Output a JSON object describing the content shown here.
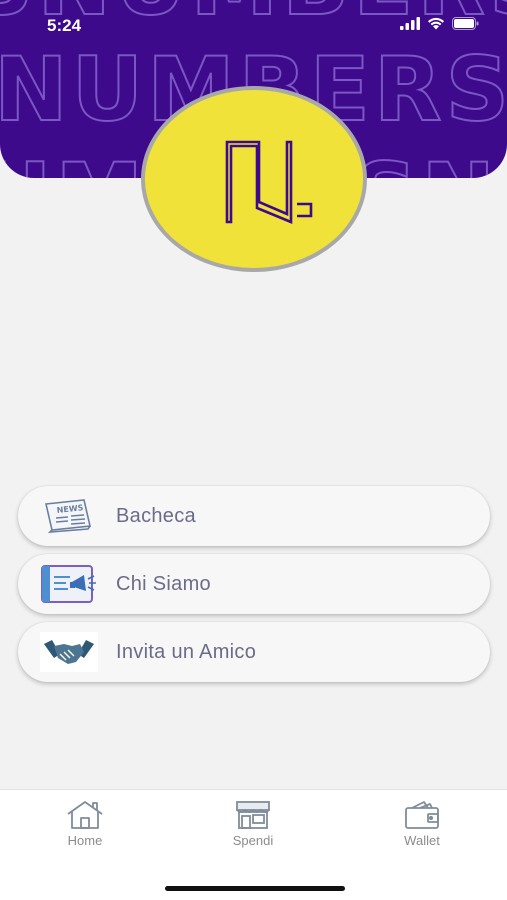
{
  "status_bar": {
    "time": "5:24"
  },
  "header": {
    "background_color": "#3d0a8c",
    "pattern_text": "NUMBERS"
  },
  "logo": {
    "background_color": "#f1e23a",
    "border_color": "#a8a8a8",
    "glyph_color": "#3d0a8c"
  },
  "menu": {
    "items": [
      {
        "label": "Bacheca",
        "icon": "newspaper-icon"
      },
      {
        "label": "Chi Siamo",
        "icon": "megaphone-icon"
      },
      {
        "label": "Invita un Amico",
        "icon": "handshake-icon"
      }
    ]
  },
  "tabbar": {
    "tabs": [
      {
        "label": "Home",
        "icon": "home-icon"
      },
      {
        "label": "Spendi",
        "icon": "store-icon"
      },
      {
        "label": "Wallet",
        "icon": "wallet-icon"
      }
    ]
  }
}
